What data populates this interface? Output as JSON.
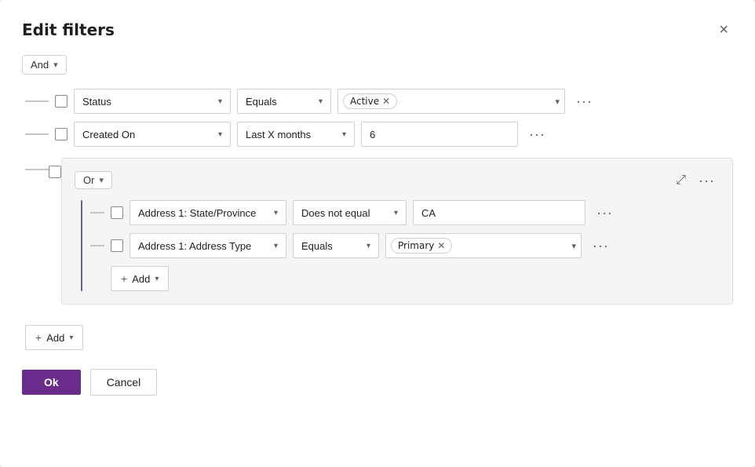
{
  "dialog": {
    "title": "Edit filters",
    "close_label": "×"
  },
  "and_group": {
    "label": "And",
    "chevron": "▾"
  },
  "filter_rows": [
    {
      "id": "status-row",
      "field": "Status",
      "operator": "Equals",
      "value_tag": "Active",
      "value_type": "tag"
    },
    {
      "id": "created-on-row",
      "field": "Created On",
      "operator": "Last X months",
      "value": "6",
      "value_type": "text"
    }
  ],
  "or_group": {
    "label": "Or",
    "chevron": "▾",
    "collapse_icon": "⤢",
    "more_icon": "···",
    "inner_rows": [
      {
        "id": "state-row",
        "field": "Address 1: State/Province",
        "operator": "Does not equal",
        "value": "CA",
        "value_type": "text"
      },
      {
        "id": "address-type-row",
        "field": "Address 1: Address Type",
        "operator": "Equals",
        "value_tag": "Primary",
        "value_type": "tag"
      }
    ],
    "add_label": "Add",
    "add_chevron": "▾"
  },
  "add_label": "Add",
  "add_chevron": "▾",
  "footer": {
    "ok_label": "Ok",
    "cancel_label": "Cancel"
  },
  "icons": {
    "chevron_down": "▾",
    "more": "···",
    "close": "✕",
    "plus": "+"
  }
}
